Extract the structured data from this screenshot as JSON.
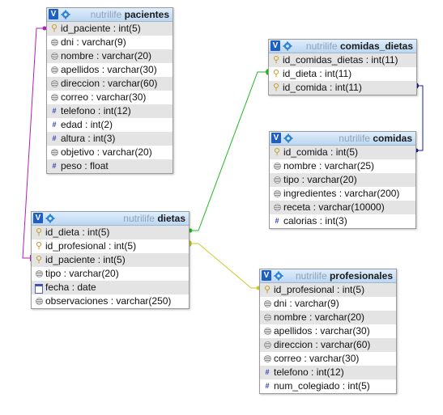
{
  "db_name": "nutrilife",
  "tables": {
    "pacientes": {
      "name": "pacientes",
      "fields": [
        {
          "icon": "key-icon",
          "text": "id_paciente : int(5)"
        },
        {
          "icon": "text-icon",
          "text": "dni : varchar(9)"
        },
        {
          "icon": "text-icon",
          "text": "nombre : varchar(20)"
        },
        {
          "icon": "text-icon",
          "text": "apellidos : varchar(30)"
        },
        {
          "icon": "text-icon",
          "text": "direccion : varchar(60)"
        },
        {
          "icon": "text-icon",
          "text": "correo : varchar(30)"
        },
        {
          "icon": "hash-icon",
          "text": "telefono : int(12)"
        },
        {
          "icon": "hash-icon",
          "text": "edad : int(2)"
        },
        {
          "icon": "hash-icon",
          "text": "altura : int(3)"
        },
        {
          "icon": "text-icon",
          "text": "objetivo : varchar(20)"
        },
        {
          "icon": "hash-icon",
          "text": "peso : float"
        }
      ]
    },
    "comidas_dietas": {
      "name": "comidas_dietas",
      "fields": [
        {
          "icon": "key-icon",
          "text": "id_comidas_dietas : int(11)"
        },
        {
          "icon": "key-icon",
          "text": "id_dieta : int(11)"
        },
        {
          "icon": "key-icon",
          "text": "id_comida : int(11)"
        }
      ]
    },
    "comidas": {
      "name": "comidas",
      "fields": [
        {
          "icon": "key-icon",
          "text": "id_comida : int(5)"
        },
        {
          "icon": "text-icon",
          "text": "nombre : varchar(25)"
        },
        {
          "icon": "text-icon",
          "text": "tipo : varchar(20)"
        },
        {
          "icon": "text-icon",
          "text": "ingredientes : varchar(200)"
        },
        {
          "icon": "text-icon",
          "text": "receta : varchar(10000)"
        },
        {
          "icon": "hash-icon",
          "text": "calorias : int(3)"
        }
      ]
    },
    "dietas": {
      "name": "dietas",
      "fields": [
        {
          "icon": "key-icon",
          "text": "id_dieta : int(5)"
        },
        {
          "icon": "key-icon",
          "text": "id_profesional : int(5)"
        },
        {
          "icon": "key-icon",
          "text": "id_paciente : int(5)"
        },
        {
          "icon": "text-icon",
          "text": "tipo : varchar(20)"
        },
        {
          "icon": "date-icon",
          "text": "fecha : date"
        },
        {
          "icon": "text-icon",
          "text": "observaciones : varchar(250)"
        }
      ]
    },
    "profesionales": {
      "name": "profesionales",
      "fields": [
        {
          "icon": "key-icon",
          "text": "id_profesional : int(5)"
        },
        {
          "icon": "text-icon",
          "text": "dni : varchar(9)"
        },
        {
          "icon": "text-icon",
          "text": "nombre : varchar(20)"
        },
        {
          "icon": "text-icon",
          "text": "apellidos : varchar(30)"
        },
        {
          "icon": "text-icon",
          "text": "direccion : varchar(60)"
        },
        {
          "icon": "text-icon",
          "text": "correo : varchar(30)"
        },
        {
          "icon": "hash-icon",
          "text": "telefono : int(12)"
        },
        {
          "icon": "hash-icon",
          "text": "num_colegiado : int(5)"
        }
      ]
    }
  },
  "relations": [
    {
      "from": "dietas.id_paciente",
      "to": "pacientes.id_paciente",
      "color": "#b31eb3"
    },
    {
      "from": "comidas_dietas.id_dieta",
      "to": "dietas.id_dieta",
      "color": "#22b822"
    },
    {
      "from": "comidas_dietas.id_comida",
      "to": "comidas.id_comida",
      "color": "#1a1aaa"
    },
    {
      "from": "dietas.id_profesional",
      "to": "profesionales.id_profesional",
      "color": "#c9c92a"
    }
  ]
}
